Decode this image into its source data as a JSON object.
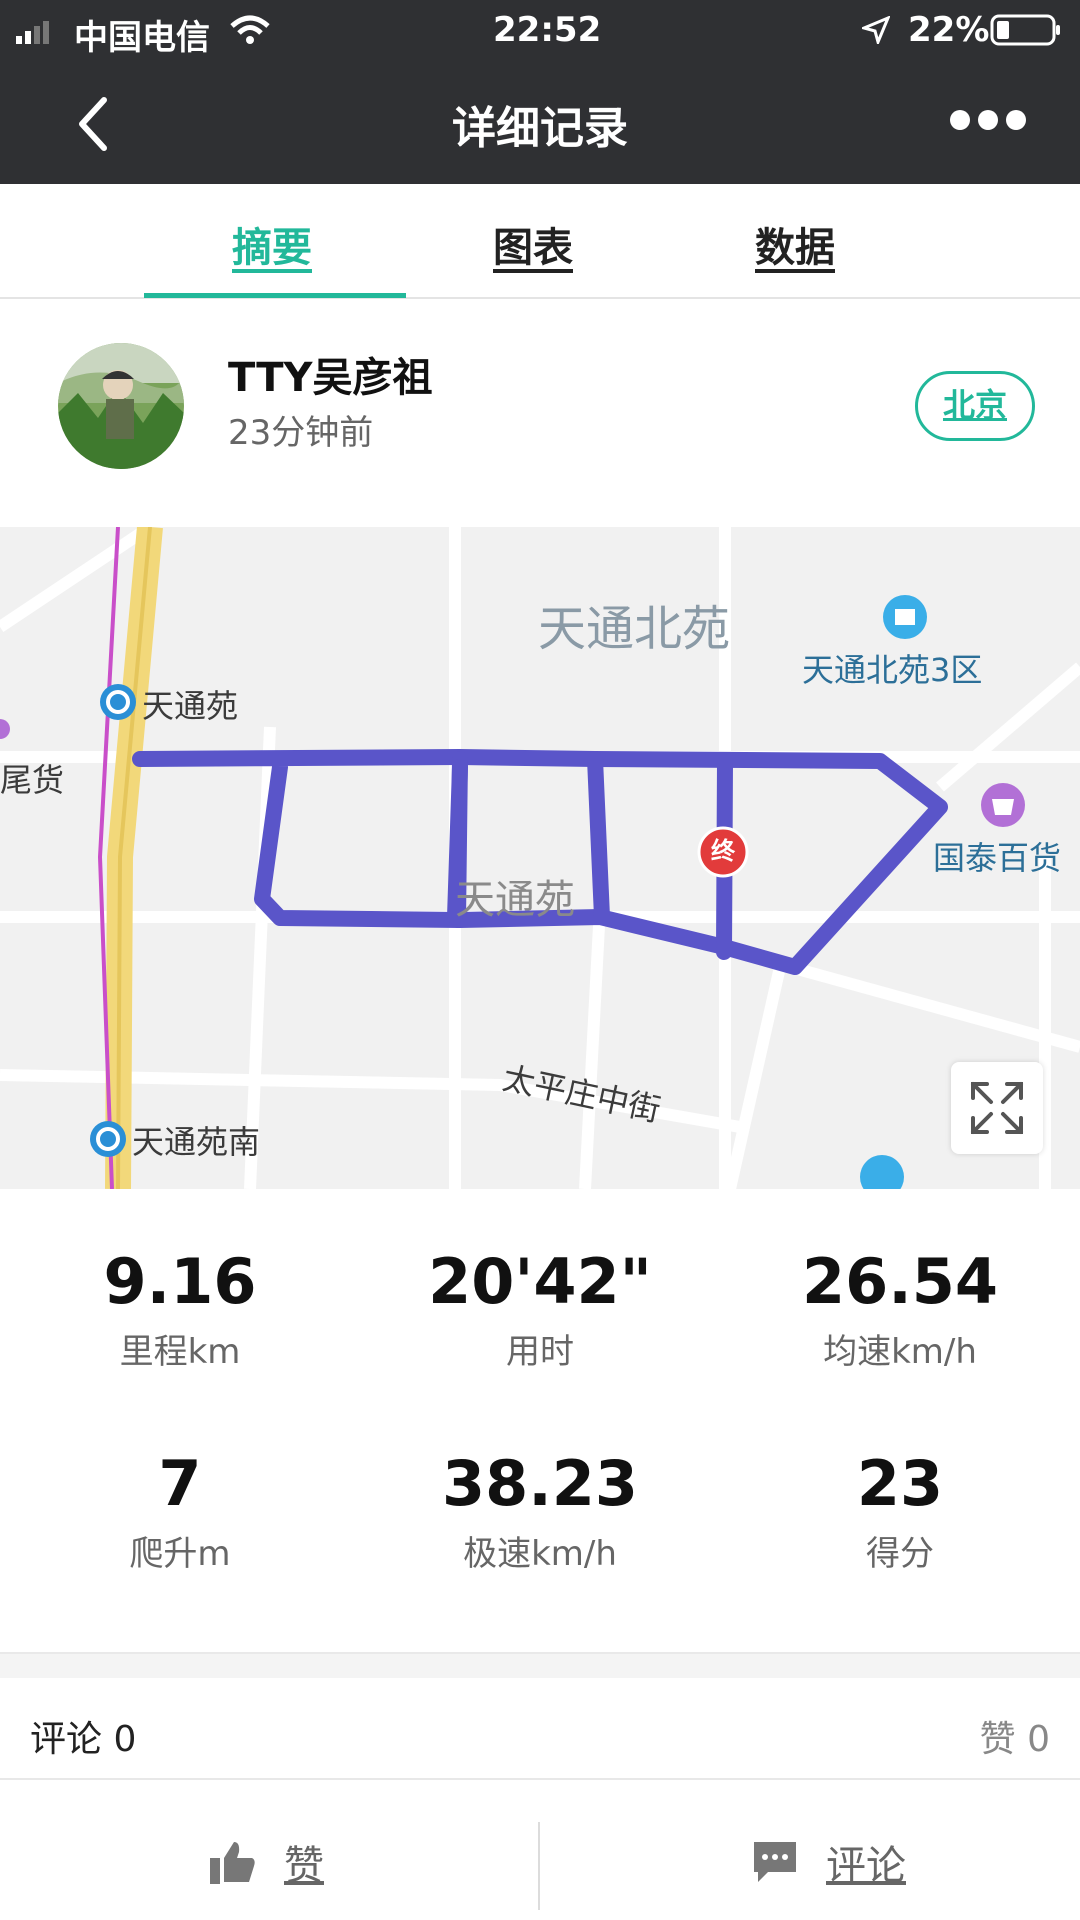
{
  "status_bar": {
    "carrier": "中国电信",
    "time": "22:52",
    "battery": "22%"
  },
  "nav": {
    "title": "详细记录",
    "back_icon": "chevron-left-icon",
    "more_icon": "more-dots-icon"
  },
  "tabs": [
    {
      "label": "摘要",
      "active": true
    },
    {
      "label": "图表",
      "active": false
    },
    {
      "label": "数据",
      "active": false
    }
  ],
  "profile": {
    "username": "TTY吴彦祖",
    "time_ago": "23分钟前",
    "city": "北京"
  },
  "map": {
    "labels": {
      "tiantong_beiyuan": "天通北苑",
      "tiantong_beiyuan_3": "天通北苑3区",
      "tiantongyuan_station": "天通苑",
      "tiantongyuan": "天通苑",
      "guotai": "国泰百货",
      "taipingzhuang": "太平庄中街",
      "tiantongyuan_nan": "天通苑南",
      "left_cut": "尾货",
      "end_marker": "终"
    }
  },
  "stats": [
    {
      "value": "9.16",
      "label": "里程km"
    },
    {
      "value": "20'42\"",
      "label": "用时"
    },
    {
      "value": "26.54",
      "label": "均速km/h"
    },
    {
      "value": "7",
      "label": "爬升m"
    },
    {
      "value": "38.23",
      "label": "极速km/h"
    },
    {
      "value": "23",
      "label": "得分"
    }
  ],
  "social": {
    "comments_label": "评论 0",
    "likes_label": "赞 0",
    "like_button": "赞",
    "comment_button": "评论"
  },
  "colors": {
    "accent": "#22b89a",
    "route": "#5a55c9",
    "header": "#2f3033"
  }
}
